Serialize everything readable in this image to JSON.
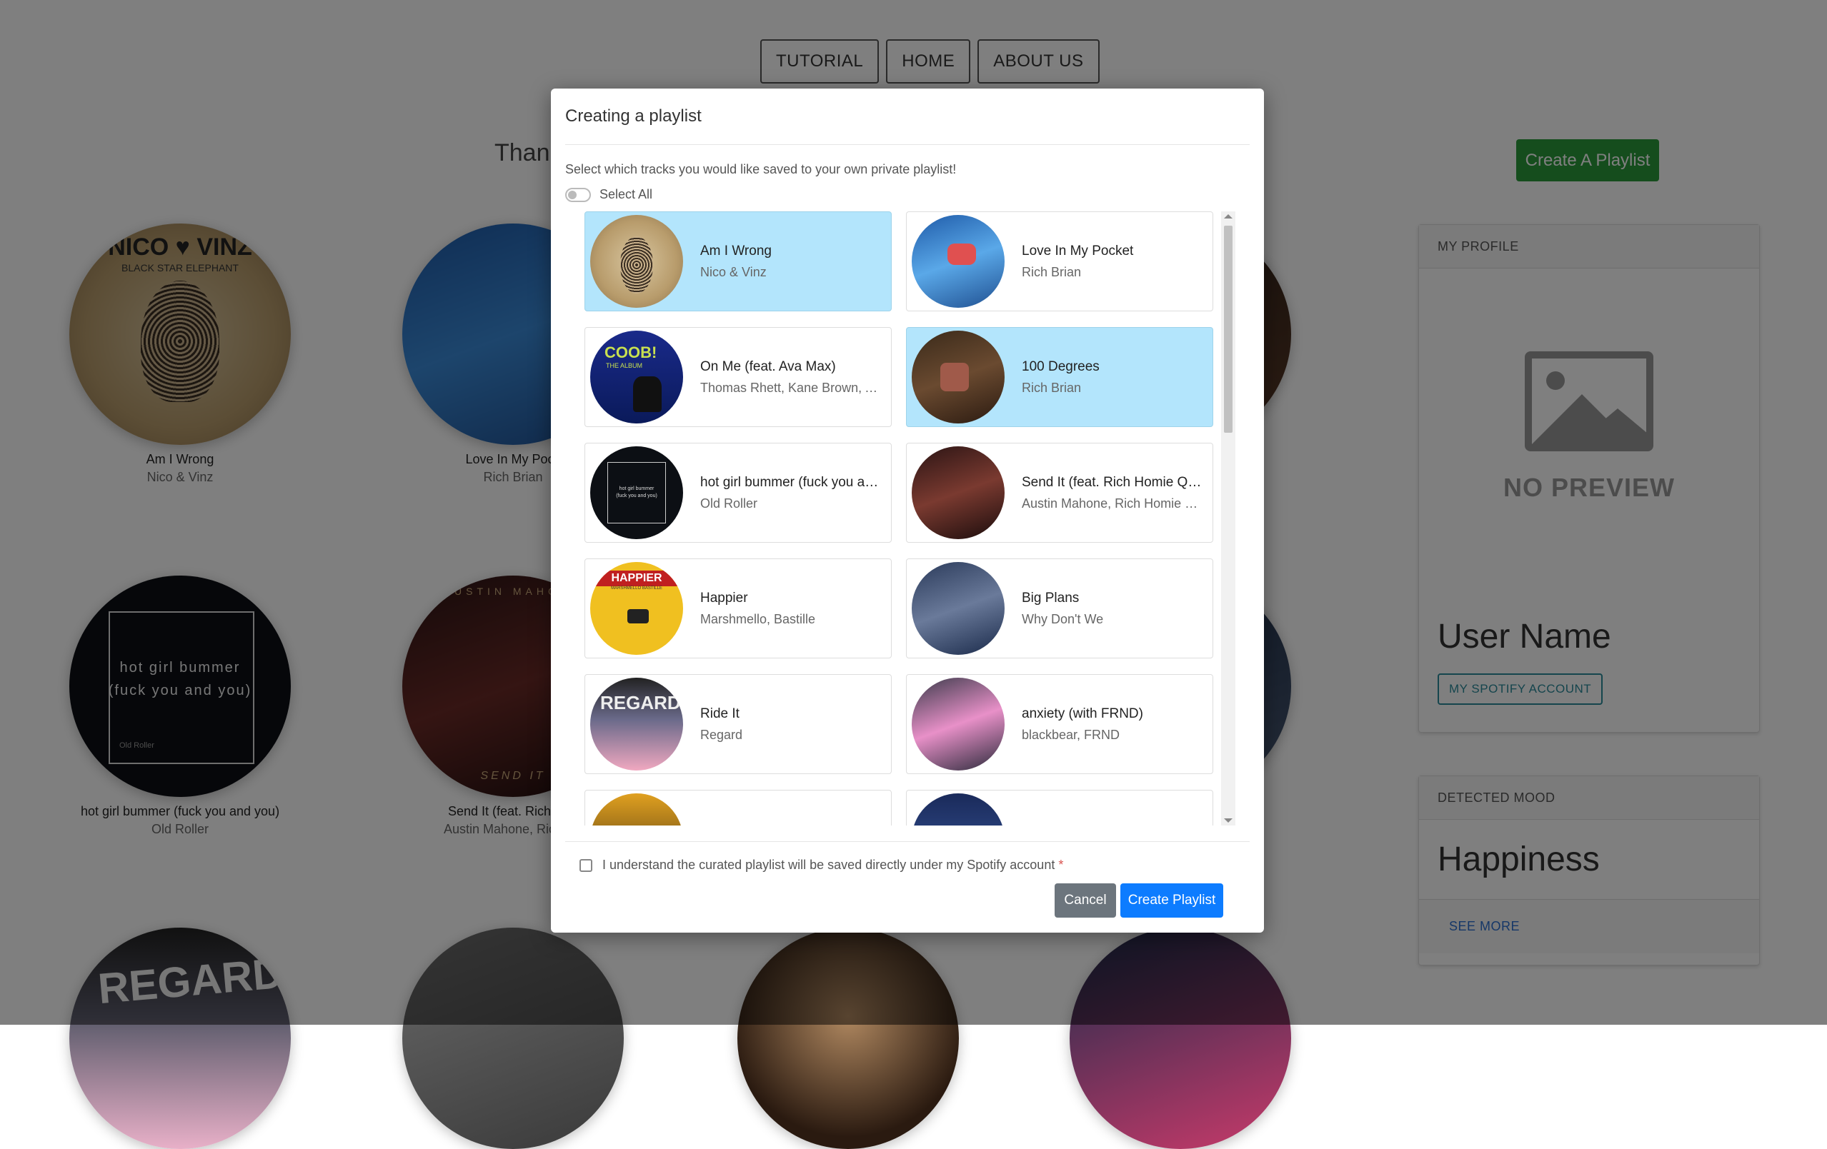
{
  "nav": {
    "items": [
      "TUTORIAL",
      "HOME",
      "ABOUT US"
    ]
  },
  "main": {
    "thanks_text": "Thank",
    "create_button": "Create A Playlist",
    "grid": [
      {
        "title": "Am I Wrong",
        "artist": "Nico & Vinz"
      },
      {
        "title": "Love In My Pock",
        "artist": "Rich Brian"
      },
      {
        "title": "hot girl bummer (fuck you and you)",
        "artist": "Old Roller"
      },
      {
        "title": "Send It (feat. Rich Hon",
        "artist": "Austin Mahone, Rich Ho"
      }
    ]
  },
  "profile": {
    "header": "MY PROFILE",
    "no_preview": "NO PREVIEW",
    "user_name": "User Name",
    "spotify_button": "MY SPOTIFY ACCOUNT"
  },
  "mood": {
    "header": "DETECTED MOOD",
    "value": "Happiness",
    "see_more": "SEE MORE"
  },
  "modal": {
    "title": "Creating a playlist",
    "instructions": "Select which tracks you would like saved to your own private playlist!",
    "select_all": "Select All",
    "tracks": [
      {
        "title": "Am I Wrong",
        "artist": "Nico & Vinz",
        "selected": true
      },
      {
        "title": "Love In My Pocket",
        "artist": "Rich Brian",
        "selected": false
      },
      {
        "title": "On Me (feat. Ava Max)",
        "artist": "Thomas Rhett, Kane Brown, A...",
        "selected": false
      },
      {
        "title": "100 Degrees",
        "artist": "Rich Brian",
        "selected": true
      },
      {
        "title": "hot girl bummer (fuck you and...",
        "artist": "Old Roller",
        "selected": false
      },
      {
        "title": "Send It (feat. Rich Homie Quan)",
        "artist": "Austin Mahone, Rich Homie Q...",
        "selected": false
      },
      {
        "title": "Happier",
        "artist": "Marshmello, Bastille",
        "selected": false
      },
      {
        "title": "Big Plans",
        "artist": "Why Don't We",
        "selected": false
      },
      {
        "title": "Ride It",
        "artist": "Regard",
        "selected": false
      },
      {
        "title": "anxiety (with FRND)",
        "artist": "blackbear, FRND",
        "selected": false
      }
    ],
    "consent_text": "I understand the curated playlist will be saved directly under my Spotify account",
    "required_mark": "*",
    "cancel": "Cancel",
    "create": "Create Playlist"
  },
  "album_art_text": {
    "nico_vinz": "NICO ♥ VINZ",
    "elephant": "BLACK STAR ELEPHANT",
    "hot_girl_line1": "hot girl bummer",
    "hot_girl_line2": "(fuck you and you)",
    "old_roller": "Old Roller",
    "send_it": "SEND IT",
    "austin": "AUSTIN MAHONE",
    "happier": "HAPPIER",
    "happier_sub": "MARSHMELLO BASTILLE",
    "regard": "REGARD",
    "on_me": "COOB!",
    "the_album": "THE ALBUM"
  }
}
